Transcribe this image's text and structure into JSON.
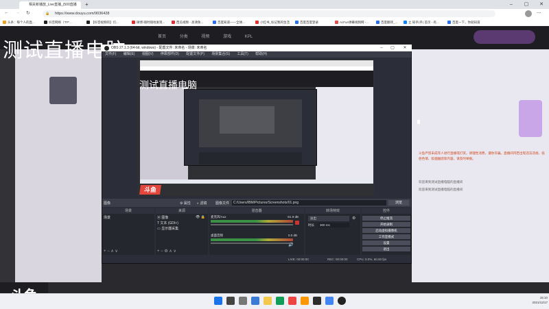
{
  "browser": {
    "tabs": [
      {
        "label": "相关新播放_Live直播_(500直播"
      }
    ],
    "url": "https://www.douyu.com/9036428",
    "bookmarks": [
      "头条：每个人的直...",
      "抖音网络（'TP'...",
      "【抖音视频的】们...",
      "微博-随时随地发现...",
      "西瓜视频 - 高清免...",
      "百度知道——全球...",
      "小红书_标记我的生活",
      "百度百度登录",
      "AcFun弹幕视频网 -...",
      "百度翻译_...",
      "立 知乎(乎) 首页 - 有...",
      "百度一下，你就知道"
    ]
  },
  "site": {
    "title": "测试直播电脑",
    "nav": [
      "首页",
      "分类",
      "视频",
      "游戏",
      "KPL"
    ],
    "logo": "斗鱼"
  },
  "obs": {
    "window_title": "OBS 27.1.3 (64-bit, windows) - 配置文件: 未命名 - 场景: 未命名",
    "menu": [
      "文件(F)",
      "编辑(E)",
      "视图(V)",
      "停靠部件(D)",
      "配置文件(P)",
      "场景集合(S)",
      "工具(T)",
      "帮助(H)"
    ],
    "preview_title": "测试直播电脑",
    "preview_logo": "斗鱼",
    "source_bar": {
      "scene_label": "图像",
      "properties": "属性",
      "filters": "滤镜",
      "file_label": "图像文件",
      "path": "C:/Users/IBM/Pictures/Screenshots/01.png",
      "browse": "浏览"
    },
    "docks": {
      "scenes": {
        "header": "场景",
        "items": [
          "场景"
        ]
      },
      "sources": {
        "header": "来源",
        "items": [
          "图像",
          "文本 (GDI+)",
          "显示器采集"
        ]
      },
      "mixer": {
        "header": "混音器",
        "channels": [
          {
            "name": "麦克风/Aux",
            "db": "-61.9 dB"
          },
          {
            "name": "桌面音频",
            "db": "0.0 dB"
          }
        ]
      },
      "transitions": {
        "header": "转场特效",
        "type": "淡出",
        "duration_label": "时长",
        "duration": "300 ms"
      },
      "controls": {
        "header": "控件",
        "buttons": [
          "停止推流",
          "开始录制",
          "启动虚拟摄像机",
          "工作室模式",
          "设置",
          "退出"
        ]
      }
    },
    "status": {
      "live": "LIVE: 00:00:00",
      "rec": "REC: 00:00:00",
      "cpu": "CPU: 0.0%, 60.00 fps"
    }
  },
  "chat": [
    {
      "user": "系统提示",
      "text": "斗鱼严禁未成年人进行直播或打赏，请理性消费，谨防诈骗。直播间内若出现违法违规、低俗色情、吸烟酗酒等内容，请及时举报。",
      "sys": true
    },
    {
      "user": "",
      "text": "欢迎来到测试直播电脑的直播间",
      "sys": false
    },
    {
      "user": "",
      "text": "欢迎来到测试直播电脑的直播间",
      "sys": false
    }
  ],
  "taskbar": {
    "time": "15:10",
    "date": "2021/12/17"
  },
  "colors": {
    "accent": "#e3463c",
    "obs_bg": "#2b2e38"
  }
}
